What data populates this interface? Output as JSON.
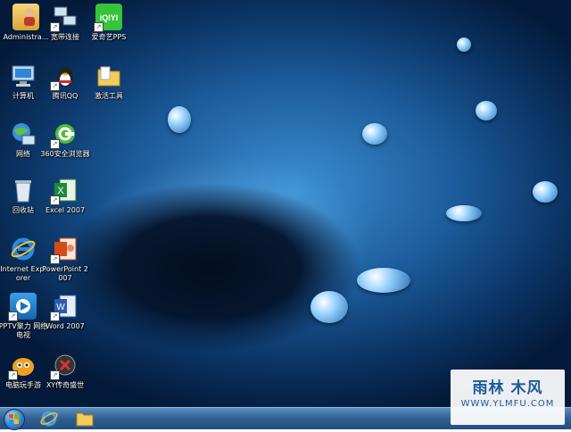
{
  "desktop_icons": [
    {
      "label": "Administra...",
      "icon": "user-folder-icon"
    },
    {
      "label": "宽带连接",
      "icon": "network-connection-icon"
    },
    {
      "label": "爱奇艺PPS",
      "icon": "iqiyi-icon"
    },
    {
      "label": "计算机",
      "icon": "computer-icon"
    },
    {
      "label": "腾讯QQ",
      "icon": "qq-penguin-icon"
    },
    {
      "label": "激活工具",
      "icon": "folder-icon"
    },
    {
      "label": "网络",
      "icon": "network-globe-icon"
    },
    {
      "label": "360安全浏览器",
      "icon": "360-browser-icon"
    },
    {
      "label": "回收站",
      "icon": "recycle-bin-icon"
    },
    {
      "label": "Excel 2007",
      "icon": "excel-icon"
    },
    {
      "label": "Internet Explorer",
      "icon": "ie-icon"
    },
    {
      "label": "PowerPoint 2007",
      "icon": "powerpoint-icon"
    },
    {
      "label": "PPTV聚力 网络电视",
      "icon": "pptv-icon"
    },
    {
      "label": "Word 2007",
      "icon": "word-icon"
    },
    {
      "label": "电脑玩手游",
      "icon": "mobile-game-icon"
    },
    {
      "label": "XY传奇盛世",
      "icon": "game-icon"
    }
  ],
  "taskbar": {
    "items": [
      "start-orb-icon",
      "ie-icon",
      "explorer-folder-icon"
    ]
  },
  "watermark": {
    "title": "雨林 木风",
    "url": "WWW.YLMFU.COM"
  },
  "colors": {
    "accent": "#1c5a9c",
    "taskbar": "#2f5f93"
  }
}
